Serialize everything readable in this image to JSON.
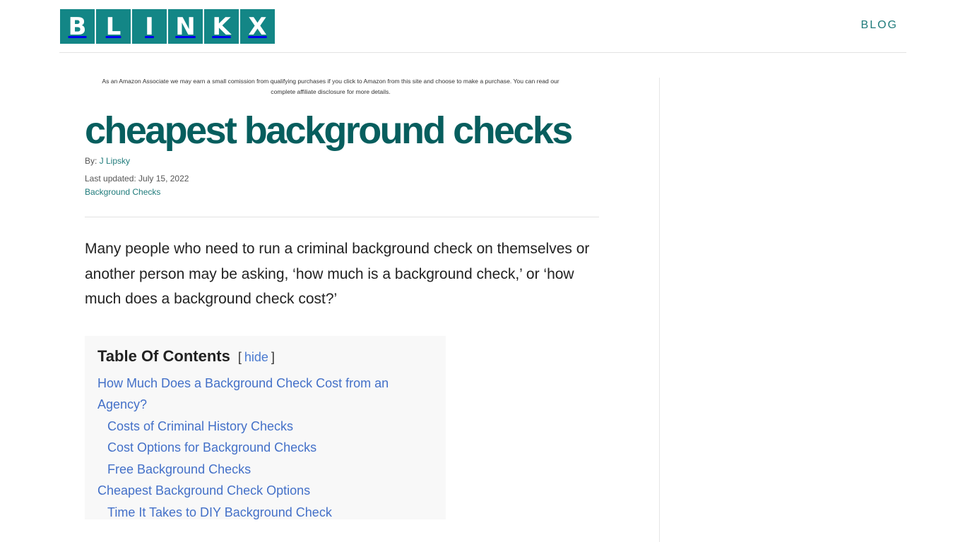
{
  "header": {
    "logo_letters": [
      "B",
      "L",
      "I",
      "N",
      "K",
      "X"
    ],
    "nav": {
      "blog_label": "BLOG"
    }
  },
  "article": {
    "disclosure": "As an Amazon Associate we may earn a small comission from qualifying purchases if you click to Amazon from this site and choose to make a purchase. You can read our complete affiliate disclosure for more details.",
    "title": "cheapest background checks",
    "author_prefix": "By: ",
    "author": "J Lipsky",
    "updated": "Last updated: July 15, 2022",
    "category": "Background Checks",
    "intro": "Many people who need to run a criminal background check on themselves or another person may be asking, ‘how much is a background check,’ or ‘how much does a background check cost?’"
  },
  "toc": {
    "title": "Table Of Contents",
    "toggle_open": "[",
    "toggle_label": "hide",
    "toggle_close": "]",
    "items": [
      {
        "label": "How Much Does a Background Check Cost from an Agency?",
        "level": 1
      },
      {
        "label": "Costs of Criminal History Checks",
        "level": 2
      },
      {
        "label": "Cost Options for Background Checks",
        "level": 2
      },
      {
        "label": "Free Background Checks",
        "level": 2
      },
      {
        "label": "Cheapest Background Check Options",
        "level": 1
      },
      {
        "label": "Time It Takes to DIY Background Check",
        "level": 2
      }
    ]
  },
  "colors": {
    "brand_teal": "#138686",
    "title_teal": "#075e5e",
    "link_teal": "#1f7b7b",
    "toc_link_blue": "#4370c8"
  }
}
